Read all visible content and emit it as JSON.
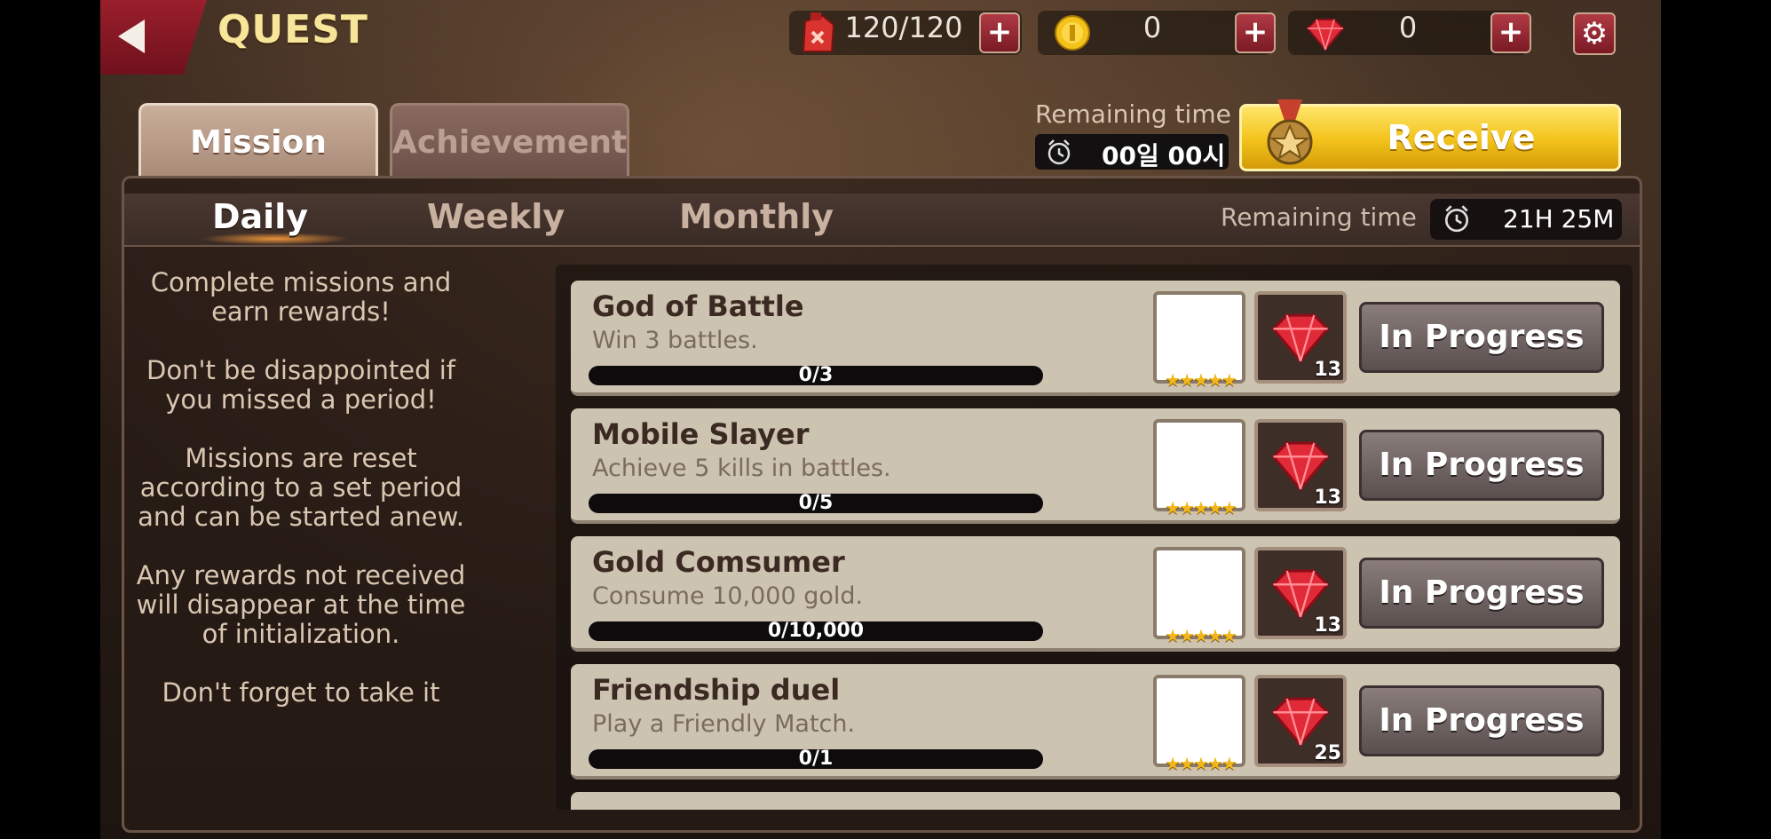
{
  "header": {
    "title": "QUEST",
    "stamina": "120/120",
    "gold": "0",
    "gems": "0"
  },
  "tabs": {
    "mission": "Mission",
    "achievement": "Achievement"
  },
  "reward": {
    "remaining_label": "Remaining time",
    "remaining_value": "00일 00시",
    "receive_label": "Receive"
  },
  "period_tabs": {
    "daily": "Daily",
    "weekly": "Weekly",
    "monthly": "Monthly",
    "remaining_label": "Remaining time",
    "remaining_value": "21H 25M"
  },
  "info": [
    "Complete missions and earn rewards!",
    "Don't be disappointed if you missed a period!",
    "Missions are reset according to a set period and can be started anew.",
    "Any rewards not received will disappear at the time of initialization.",
    "Don't forget to take it"
  ],
  "missions": [
    {
      "title": "God of Battle",
      "desc": "Win 3 battles.",
      "progress": "0/3",
      "fraction": 0,
      "gems": "13",
      "status": "In Progress"
    },
    {
      "title": "Mobile Slayer",
      "desc": "Achieve 5 kills in battles.",
      "progress": "0/5",
      "fraction": 0,
      "gems": "13",
      "status": "In Progress"
    },
    {
      "title": "Gold Comsumer",
      "desc": "Consume 10,000 gold.",
      "progress": "0/10,000",
      "fraction": 0,
      "gems": "13",
      "status": "In Progress"
    },
    {
      "title": "Friendship duel",
      "desc": "Play a Friendly Match.",
      "progress": "0/1",
      "fraction": 0,
      "gems": "25",
      "status": "In Progress"
    }
  ],
  "colors": {
    "accent_gold": "#f2c21a",
    "accent_red": "#9a1f2c",
    "star": "#f0b71c"
  }
}
